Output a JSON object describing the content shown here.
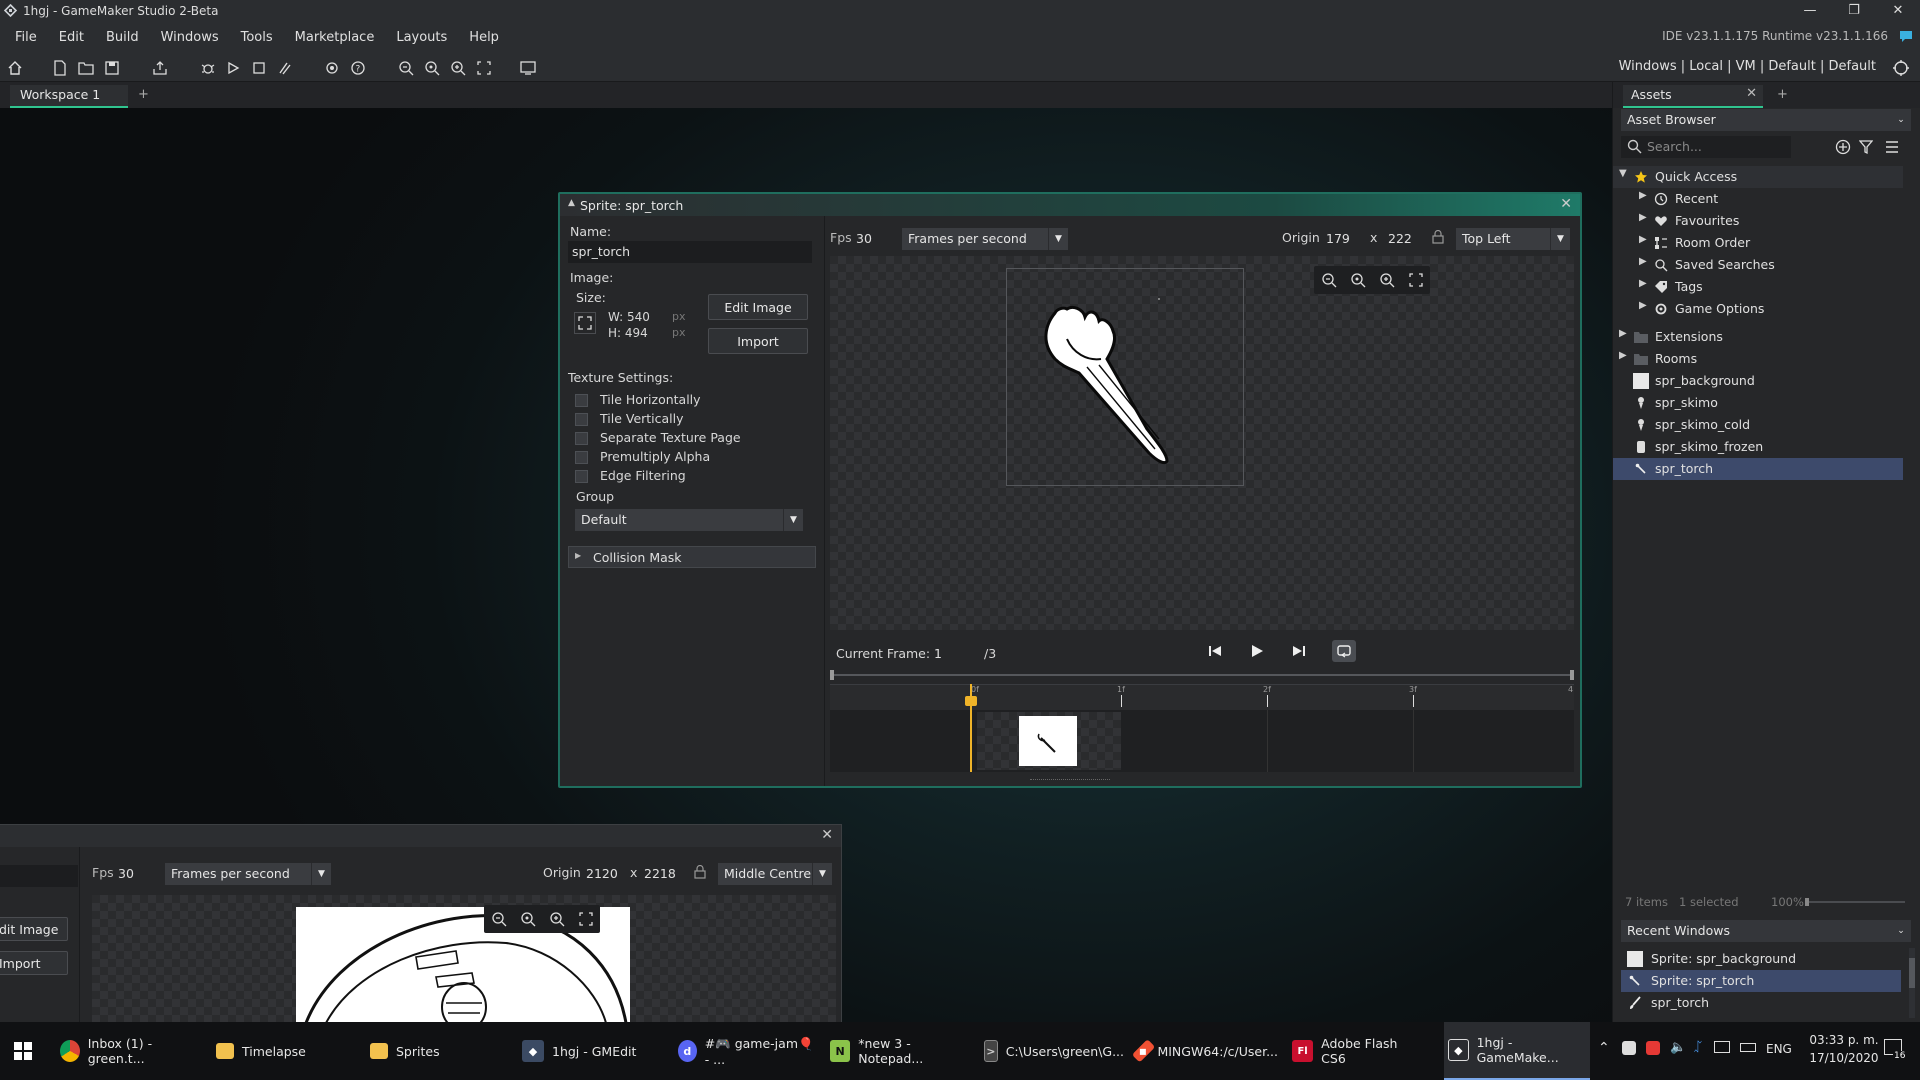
{
  "window": {
    "title": "1hgj - GameMaker Studio 2-Beta"
  },
  "menu": {
    "items": [
      "File",
      "Edit",
      "Build",
      "Windows",
      "Tools",
      "Marketplace",
      "Layouts",
      "Help"
    ],
    "version": "IDE v23.1.1.175  Runtime v23.1.1.166"
  },
  "toolbar": {
    "targets": "Windows  |  Local  |  VM  |  Default  |  Default"
  },
  "workspace": {
    "tab": "Workspace 1",
    "add": "+"
  },
  "sprite": {
    "title": "Sprite: spr_torch",
    "name_label": "Name:",
    "name_value": "spr_torch",
    "image_label": "Image:",
    "size_label": "Size:",
    "width": "W: 540",
    "height": "H: 494",
    "px": "px",
    "edit_image": "Edit Image",
    "import": "Import",
    "texture_label": "Texture Settings:",
    "checkboxes": [
      "Tile Horizontally",
      "Tile Vertically",
      "Separate Texture Page",
      "Premultiply Alpha",
      "Edge Filtering"
    ],
    "group_label": "Group",
    "group_value": "Default",
    "collision_mask": "Collision Mask",
    "fps_label": "Fps",
    "fps_value": "30",
    "fps_mode": "Frames per second",
    "origin_label": "Origin",
    "origin_x": "179",
    "origin_sep": "x",
    "origin_y": "222",
    "origin_preset": "Top Left",
    "current_frame_label": "Current Frame:",
    "current_frame": "1",
    "frame_total": "/3",
    "timeline_marks": [
      "0f",
      "1f",
      "2f",
      "3f",
      "4"
    ]
  },
  "sprite2": {
    "fps_label": "Fps",
    "fps_value": "30",
    "fps_mode": "Frames per second",
    "origin_label": "Origin",
    "origin_x": "2120",
    "origin_sep": "x",
    "origin_y": "2218",
    "origin_preset": "Middle Centre",
    "edit_image": "dit Image",
    "import": "Import"
  },
  "assets": {
    "tab": "Assets",
    "browser": "Asset Browser",
    "search_placeholder": "Search...",
    "quick_access": "Quick Access",
    "qa_items": [
      "Recent",
      "Favourites",
      "Room Order",
      "Saved Searches",
      "Tags",
      "Game Options"
    ],
    "folders": [
      "Extensions",
      "Rooms"
    ],
    "sprites": [
      "spr_background",
      "spr_skimo",
      "spr_skimo_cold",
      "spr_skimo_frozen",
      "spr_torch"
    ],
    "status_items": "7 items",
    "status_selected": "1 selected",
    "zoom": "100%"
  },
  "recent": {
    "title": "Recent Windows",
    "items": [
      "Sprite: spr_background",
      "Sprite: spr_torch",
      "spr_torch"
    ]
  },
  "taskbar": {
    "items": [
      "Inbox (1) - green.t...",
      "Timelapse",
      "Sprites",
      "1hgj - GMEdit",
      "#🎮 game-jam🎈 - ...",
      "*new 3 - Notepad...",
      "C:\\Users\\green\\G...",
      "MINGW64:/c/User...",
      "Adobe Flash CS6",
      "1hgj - GameMake..."
    ],
    "lang": "ENG",
    "time": "03:33 p. m.",
    "date": "17/10/2020",
    "notif": "16"
  },
  "colors": {
    "accent": "#30c48f",
    "selection": "#3d4a6b",
    "playhead": "#f0b429"
  }
}
